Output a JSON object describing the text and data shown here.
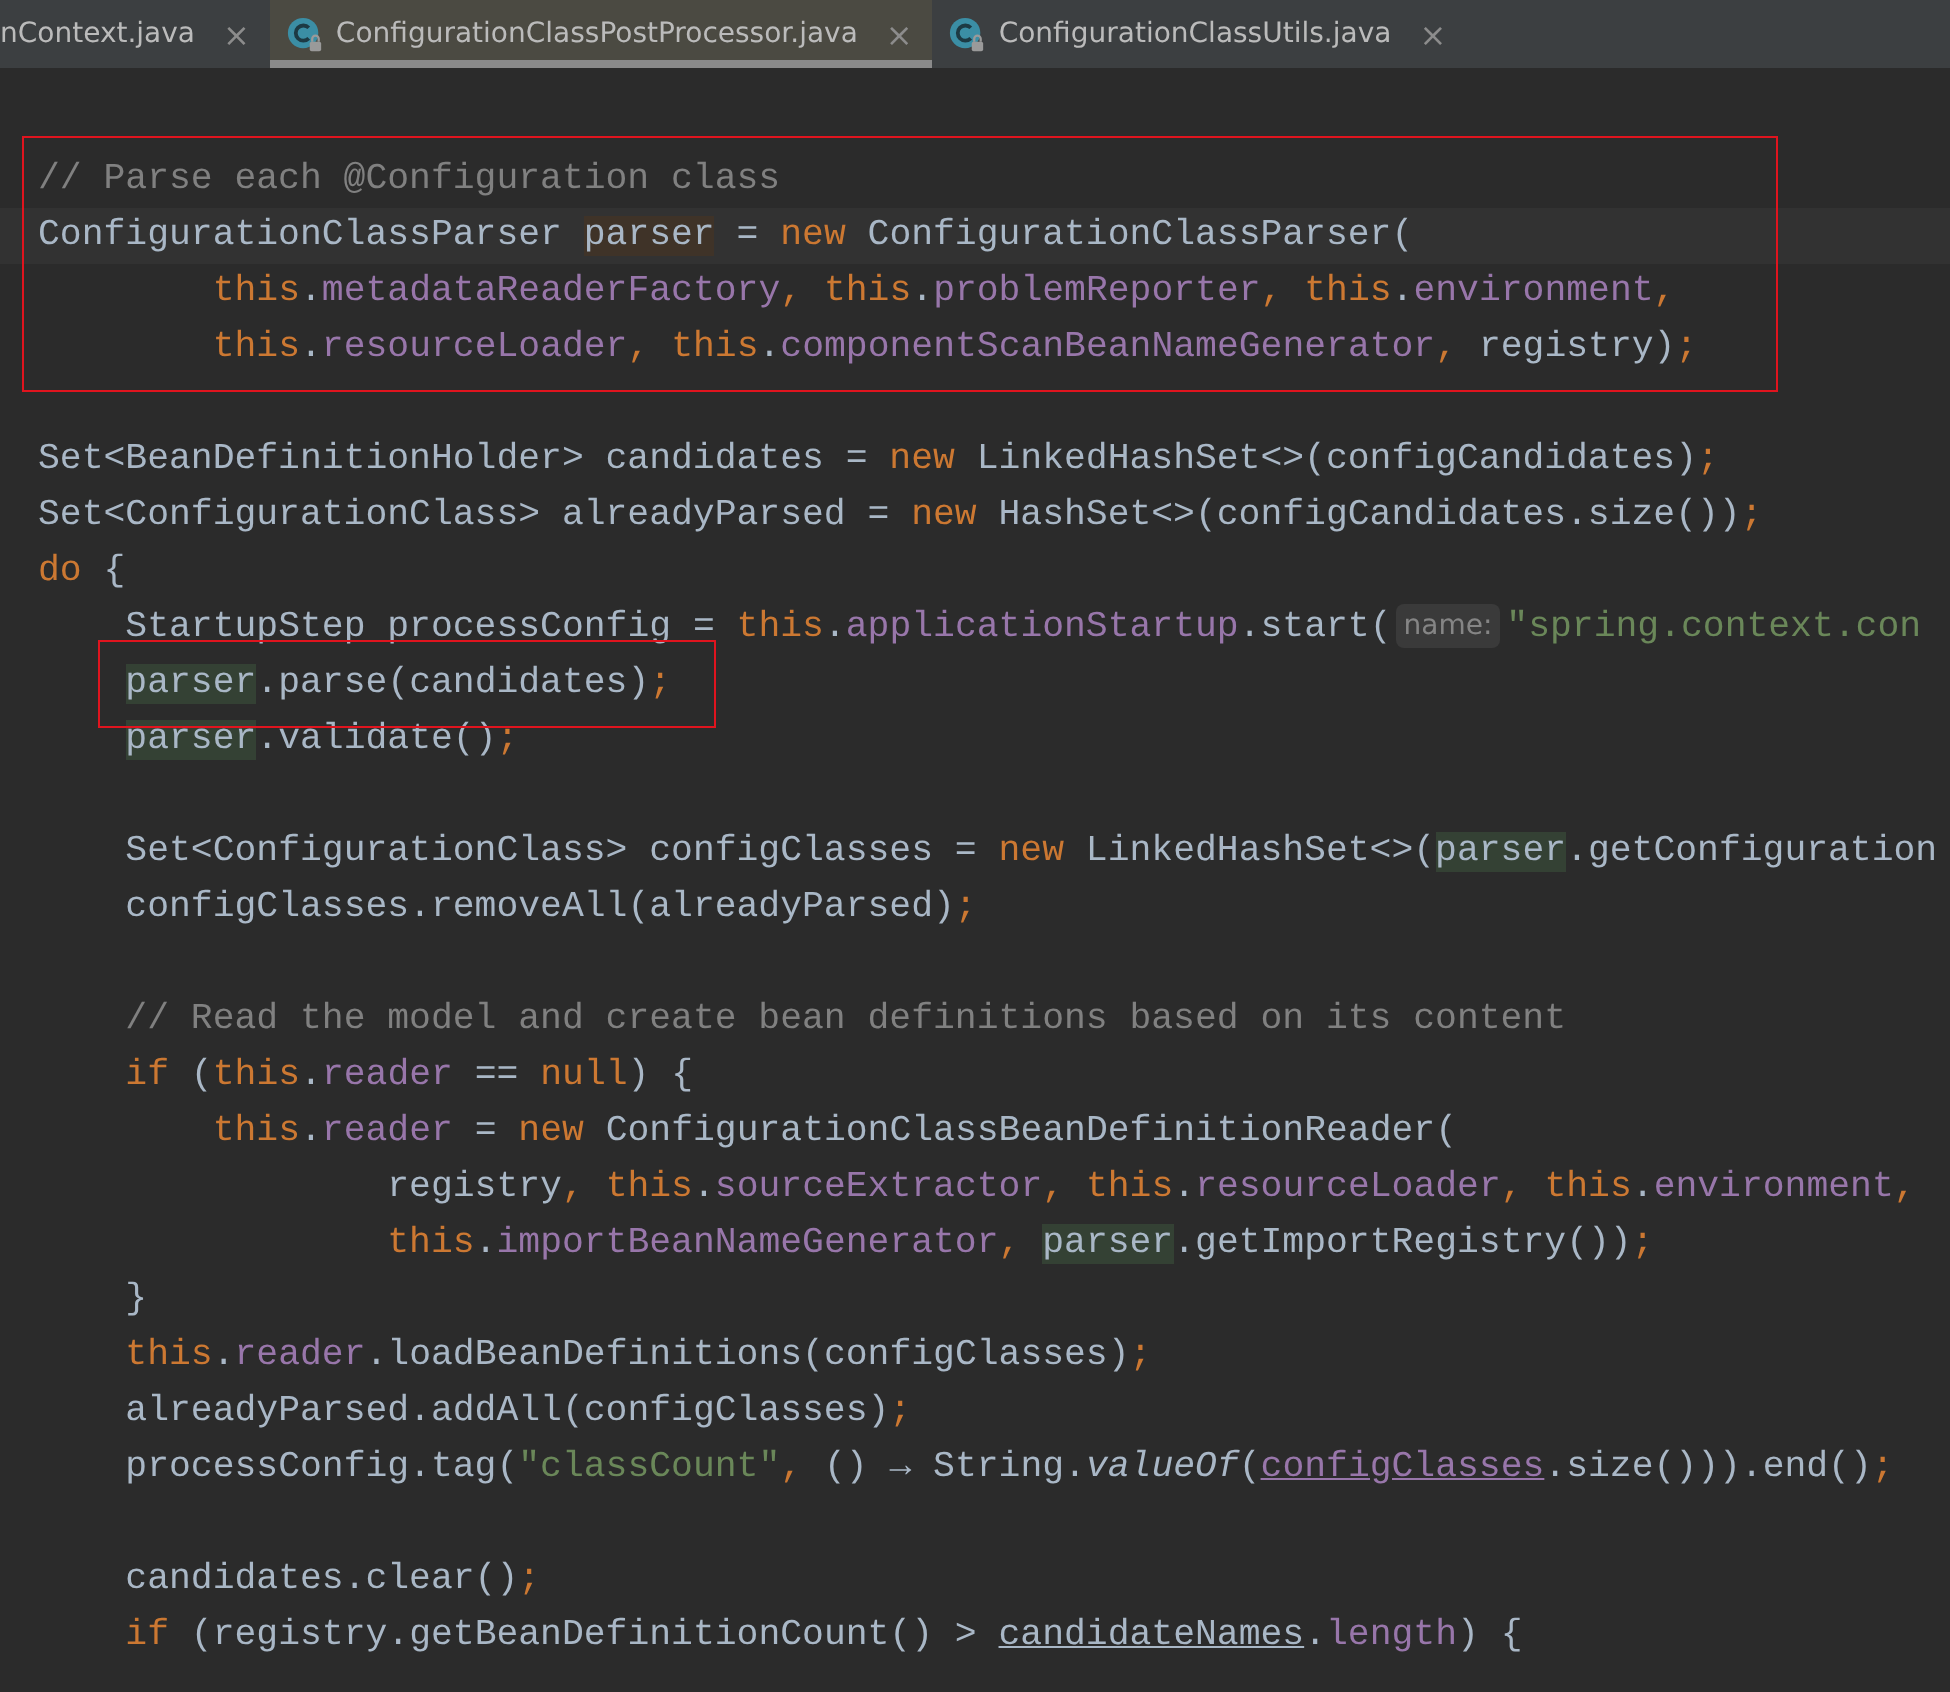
{
  "tabs": [
    {
      "label": "nContext.java",
      "selected": false,
      "kind": "file",
      "close": "×"
    },
    {
      "label": "ConfigurationClassPostProcessor.java",
      "selected": true,
      "kind": "class",
      "close": "×"
    },
    {
      "label": "ConfigurationClassUtils.java",
      "selected": false,
      "kind": "class",
      "close": "×"
    }
  ],
  "editor": {
    "blocks": [
      {
        "lines": [
          {
            "framed": true,
            "tokens": [
              {
                "text": "// Parse each @Configuration class",
                "kind": "comment"
              }
            ]
          },
          {
            "framed": true,
            "current": true,
            "tokens": [
              {
                "text": "ConfigurationClassParser ",
                "kind": "plain"
              },
              {
                "text": "parser",
                "kind": "declaration"
              },
              {
                "text": " = ",
                "kind": "plain"
              },
              {
                "text": "new",
                "kind": "keyword"
              },
              {
                "text": " ConfigurationClassParser(",
                "kind": "plain"
              }
            ]
          },
          {
            "framed": true,
            "tokens": [
              {
                "text": "        this",
                "kind": "keyword"
              },
              {
                "text": ".",
                "kind": "plain"
              },
              {
                "text": "metadataReaderFactory",
                "kind": "field"
              },
              {
                "text": ", ",
                "kind": "punct"
              },
              {
                "text": "this",
                "kind": "keyword"
              },
              {
                "text": ".",
                "kind": "plain"
              },
              {
                "text": "problemReporter",
                "kind": "field"
              },
              {
                "text": ", ",
                "kind": "punct"
              },
              {
                "text": "this",
                "kind": "keyword"
              },
              {
                "text": ".",
                "kind": "plain"
              },
              {
                "text": "environment",
                "kind": "field"
              },
              {
                "text": ",",
                "kind": "punct"
              }
            ]
          },
          {
            "framed": true,
            "tokens": [
              {
                "text": "        this",
                "kind": "keyword"
              },
              {
                "text": ".",
                "kind": "plain"
              },
              {
                "text": "resourceLoader",
                "kind": "field"
              },
              {
                "text": ", ",
                "kind": "punct"
              },
              {
                "text": "this",
                "kind": "keyword"
              },
              {
                "text": ".",
                "kind": "plain"
              },
              {
                "text": "componentScanBeanNameGenerator",
                "kind": "field"
              },
              {
                "text": ", ",
                "kind": "punct"
              },
              {
                "text": "registry)",
                "kind": "plain"
              },
              {
                "text": ";",
                "kind": "punct"
              }
            ]
          }
        ]
      },
      {
        "lines": [
          {
            "tokens": [
              {
                "text": "Set<BeanDefinitionHolder> candidates = ",
                "kind": "plain"
              },
              {
                "text": "new",
                "kind": "keyword"
              },
              {
                "text": " LinkedHashSet<>(configCandidates)",
                "kind": "plain"
              },
              {
                "text": ";",
                "kind": "punct"
              }
            ]
          },
          {
            "tokens": [
              {
                "text": "Set<ConfigurationClass> alreadyParsed = ",
                "kind": "plain"
              },
              {
                "text": "new",
                "kind": "keyword"
              },
              {
                "text": " HashSet<>(configCandidates.size())",
                "kind": "plain"
              },
              {
                "text": ";",
                "kind": "punct"
              }
            ]
          },
          {
            "tokens": [
              {
                "text": "do",
                "kind": "keyword"
              },
              {
                "text": " {",
                "kind": "plain"
              }
            ]
          },
          {
            "tokens": [
              {
                "text": "    StartupStep processConfig = ",
                "kind": "plain"
              },
              {
                "text": "this",
                "kind": "keyword"
              },
              {
                "text": ".",
                "kind": "plain"
              },
              {
                "text": "applicationStartup",
                "kind": "field"
              },
              {
                "text": ".start(",
                "kind": "plain"
              },
              {
                "text": "name:",
                "kind": "hint"
              },
              {
                "text": "\"spring.context.con",
                "kind": "string"
              }
            ]
          },
          {
            "framed": true,
            "tokens": [
              {
                "text": "    parser",
                "kind": "usage"
              },
              {
                "text": ".parse(candidates)",
                "kind": "plain"
              },
              {
                "text": ";",
                "kind": "punct"
              }
            ]
          },
          {
            "tokens": [
              {
                "text": "    parser",
                "kind": "usage"
              },
              {
                "text": ".validate()",
                "kind": "plain"
              },
              {
                "text": ";",
                "kind": "punct"
              }
            ]
          }
        ]
      },
      {
        "lines": [
          {
            "tokens": [
              {
                "text": "    Set<ConfigurationClass> configClasses = ",
                "kind": "plain"
              },
              {
                "text": "new",
                "kind": "keyword"
              },
              {
                "text": " LinkedHashSet<>(",
                "kind": "plain"
              },
              {
                "text": "parser",
                "kind": "usage"
              },
              {
                "text": ".getConfiguration",
                "kind": "plain"
              }
            ]
          },
          {
            "tokens": [
              {
                "text": "    configClasses.removeAll(alreadyParsed)",
                "kind": "plain"
              },
              {
                "text": ";",
                "kind": "punct"
              }
            ]
          }
        ]
      },
      {
        "lines": [
          {
            "tokens": [
              {
                "text": "    // Read the model and create bean definitions based on its content",
                "kind": "comment"
              }
            ]
          },
          {
            "tokens": [
              {
                "text": "    if",
                "kind": "keyword"
              },
              {
                "text": " (",
                "kind": "plain"
              },
              {
                "text": "this",
                "kind": "keyword"
              },
              {
                "text": ".",
                "kind": "plain"
              },
              {
                "text": "reader",
                "kind": "field"
              },
              {
                "text": " == ",
                "kind": "plain"
              },
              {
                "text": "null",
                "kind": "keyword"
              },
              {
                "text": ") {",
                "kind": "plain"
              }
            ]
          },
          {
            "tokens": [
              {
                "text": "        this",
                "kind": "keyword"
              },
              {
                "text": ".",
                "kind": "plain"
              },
              {
                "text": "reader",
                "kind": "field"
              },
              {
                "text": " = ",
                "kind": "plain"
              },
              {
                "text": "new",
                "kind": "keyword"
              },
              {
                "text": " ConfigurationClassBeanDefinitionReader(",
                "kind": "plain"
              }
            ]
          },
          {
            "tokens": [
              {
                "text": "                registry",
                "kind": "plain"
              },
              {
                "text": ", ",
                "kind": "punct"
              },
              {
                "text": "this",
                "kind": "keyword"
              },
              {
                "text": ".",
                "kind": "plain"
              },
              {
                "text": "sourceExtractor",
                "kind": "field"
              },
              {
                "text": ", ",
                "kind": "punct"
              },
              {
                "text": "this",
                "kind": "keyword"
              },
              {
                "text": ".",
                "kind": "plain"
              },
              {
                "text": "resourceLoader",
                "kind": "field"
              },
              {
                "text": ", ",
                "kind": "punct"
              },
              {
                "text": "this",
                "kind": "keyword"
              },
              {
                "text": ".",
                "kind": "plain"
              },
              {
                "text": "environment",
                "kind": "field"
              },
              {
                "text": ",",
                "kind": "punct"
              }
            ]
          },
          {
            "tokens": [
              {
                "text": "                this",
                "kind": "keyword"
              },
              {
                "text": ".",
                "kind": "plain"
              },
              {
                "text": "importBeanNameGenerator",
                "kind": "field"
              },
              {
                "text": ", ",
                "kind": "punct"
              },
              {
                "text": "parser",
                "kind": "usage"
              },
              {
                "text": ".getImportRegistry())",
                "kind": "plain"
              },
              {
                "text": ";",
                "kind": "punct"
              }
            ]
          },
          {
            "tokens": [
              {
                "text": "    }",
                "kind": "plain"
              }
            ]
          },
          {
            "tokens": [
              {
                "text": "    this",
                "kind": "keyword"
              },
              {
                "text": ".",
                "kind": "plain"
              },
              {
                "text": "reader",
                "kind": "field"
              },
              {
                "text": ".loadBeanDefinitions(configClasses)",
                "kind": "plain"
              },
              {
                "text": ";",
                "kind": "punct"
              }
            ]
          },
          {
            "tokens": [
              {
                "text": "    alreadyParsed.addAll(configClasses)",
                "kind": "plain"
              },
              {
                "text": ";",
                "kind": "punct"
              }
            ]
          },
          {
            "tokens": [
              {
                "text": "    processConfig.tag(",
                "kind": "plain"
              },
              {
                "text": "\"classCount\"",
                "kind": "string"
              },
              {
                "text": ", ",
                "kind": "punct"
              },
              {
                "text": "() → String.",
                "kind": "plain"
              },
              {
                "text": "valueOf",
                "kind": "static"
              },
              {
                "text": "(",
                "kind": "plain"
              },
              {
                "text": "configClasses",
                "kind": "captured-field"
              },
              {
                "text": ".size())).end()",
                "kind": "plain"
              },
              {
                "text": ";",
                "kind": "punct"
              }
            ]
          }
        ]
      },
      {
        "lines": [
          {
            "tokens": [
              {
                "text": "    candidates.clear()",
                "kind": "plain"
              },
              {
                "text": ";",
                "kind": "punct"
              }
            ]
          },
          {
            "tokens": [
              {
                "text": "    if",
                "kind": "keyword"
              },
              {
                "text": " (registry.getBeanDefinitionCount() > ",
                "kind": "plain"
              },
              {
                "text": "candidateNames",
                "kind": "captured"
              },
              {
                "text": ".",
                "kind": "plain"
              },
              {
                "text": "length",
                "kind": "field"
              },
              {
                "text": ") {",
                "kind": "plain"
              }
            ]
          }
        ]
      }
    ]
  }
}
